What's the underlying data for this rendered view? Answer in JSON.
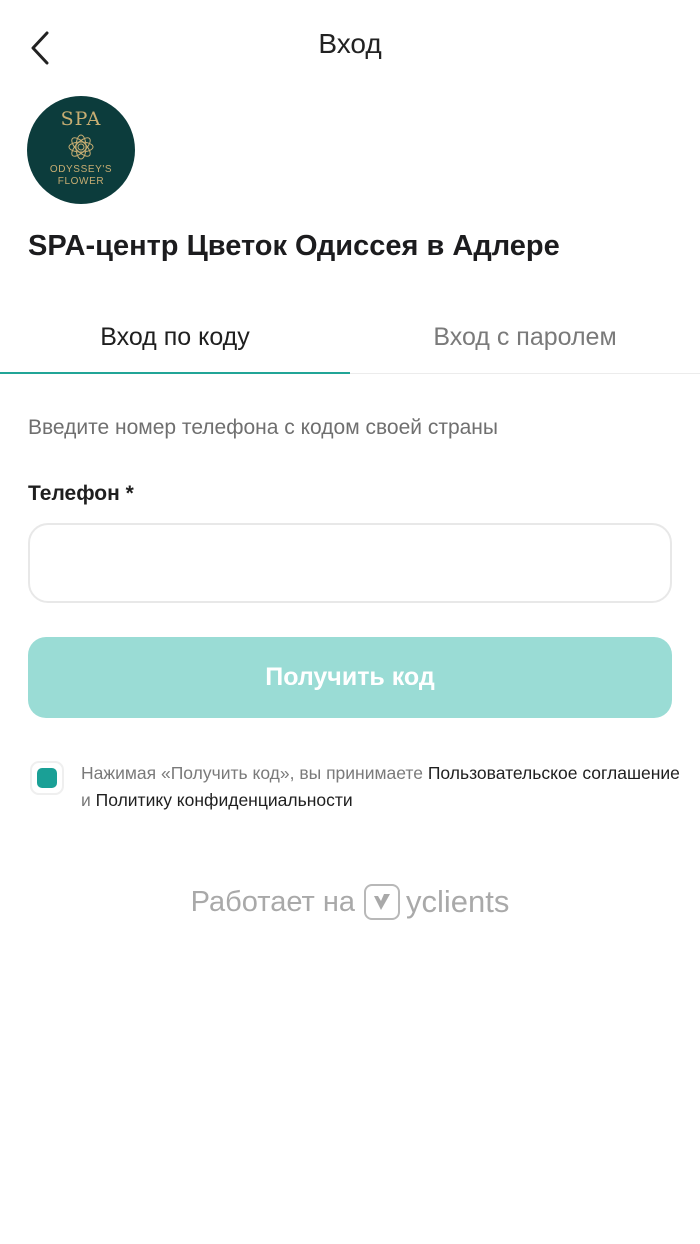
{
  "header": {
    "title": "Вход",
    "back_icon": "chevron-left-icon"
  },
  "logo": {
    "line1": "SPA",
    "line2": "ODYSSEY'S",
    "line3": "FLOWER",
    "background": "#0c3c3c",
    "foreground": "#c7ad72"
  },
  "company": {
    "name": "SPA-центр Цветок Одиссея в Адлере"
  },
  "tabs": [
    {
      "label": "Вход по коду",
      "active": true
    },
    {
      "label": "Вход с паролем",
      "active": false
    }
  ],
  "form": {
    "hint": "Введите номер телефона с кодом своей страны",
    "phone_label": "Телефон *",
    "phone_value": "",
    "phone_placeholder": "",
    "submit_label": "Получить код"
  },
  "agreement": {
    "checked": true,
    "prefix": "Нажимая «Получить код», вы принимаете ",
    "terms_link": "Пользовательское соглашение",
    "conjunction": " и ",
    "privacy_link": "Политику конфиденциальности"
  },
  "footer": {
    "powered_by": "Работает на",
    "brand": "yclients",
    "brand_icon": "yclients-logo-icon"
  },
  "colors": {
    "accent": "#21a597",
    "button_disabled": "#9adcd5",
    "checkbox": "#1aa096"
  }
}
